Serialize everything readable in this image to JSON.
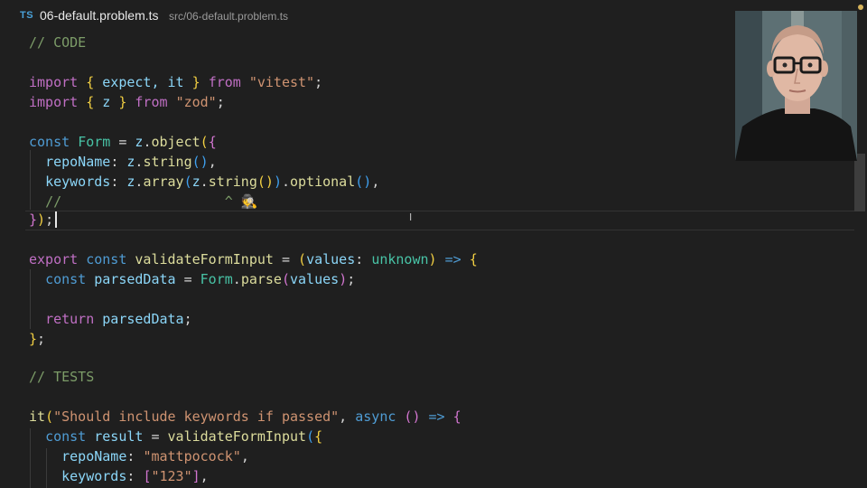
{
  "tab": {
    "language_badge": "TS",
    "filename": "06-default.problem.ts",
    "path": "src/06-default.problem.ts"
  },
  "code": {
    "comment_code": "// CODE",
    "import1": {
      "kw": "import",
      "names": "expect, it",
      "from": "from",
      "module": "\"vitest\""
    },
    "import2": {
      "kw": "import",
      "names": "z",
      "from": "from",
      "module": "\"zod\""
    },
    "form_decl": {
      "kw": "const",
      "name": "Form",
      "obj": "z",
      "method": "object"
    },
    "repo_prop": {
      "key": "repoName",
      "obj": "z",
      "method": "string"
    },
    "keywords_prop": {
      "key": "keywords",
      "obj": "z",
      "method": "array",
      "inner_obj": "z",
      "inner_method": "string",
      "chain": "optional"
    },
    "comment_marker": "//                    ^ 🕵",
    "close_obj": "});",
    "validate_decl": {
      "export": "export",
      "kw": "const",
      "name": "validateFormInput",
      "param": "values",
      "type": "unknown",
      "arrow": "=>"
    },
    "parsed_line": {
      "kw": "const",
      "name": "parsedData",
      "obj": "Form",
      "method": "parse",
      "arg": "values"
    },
    "return_line": {
      "kw": "return",
      "name": "parsedData"
    },
    "close_fn": "};",
    "comment_tests": "// TESTS",
    "it_line": {
      "fn": "it",
      "desc": "\"Should include keywords if passed\"",
      "async": "async",
      "arrow": "=>"
    },
    "result_line": {
      "kw": "const",
      "name": "result",
      "fn": "validateFormInput"
    },
    "repo_value_line": {
      "key": "repoName",
      "value": "\"mattpocock\""
    },
    "keywords_value_line": {
      "key": "keywords",
      "value": "\"123\""
    }
  }
}
